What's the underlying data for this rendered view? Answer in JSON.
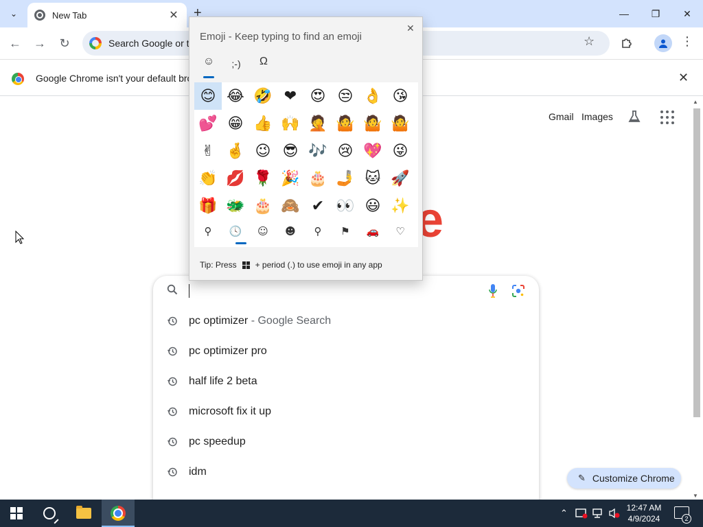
{
  "window": {
    "tab_title": "New Tab",
    "tab_close_glyph": "✕",
    "new_tab_glyph": "+",
    "tab_search_glyph": "⌄",
    "minimize_glyph": "—",
    "restore_glyph": "❐",
    "close_glyph": "✕"
  },
  "toolbar": {
    "back_glyph": "←",
    "forward_glyph": "→",
    "reload_glyph": "↻",
    "omnibox_text": "Search Google or ty",
    "star_glyph": "☆",
    "menu_glyph": "⋮"
  },
  "infobar": {
    "text": "Google Chrome isn't your default brow",
    "close_glyph": "✕"
  },
  "page": {
    "links": {
      "gmail": "Gmail",
      "images": "Images"
    },
    "logo_partial": "e",
    "customize_label": "Customize Chrome",
    "pencil_glyph": "✎"
  },
  "suggestions": [
    {
      "text": "pc optimizer",
      "tail": " - Google Search"
    },
    {
      "text": "pc optimizer pro",
      "tail": ""
    },
    {
      "text": "half life 2 beta",
      "tail": ""
    },
    {
      "text": "microsoft fix it up",
      "tail": ""
    },
    {
      "text": "pc speedup",
      "tail": ""
    },
    {
      "text": "idm",
      "tail": ""
    }
  ],
  "emoji_panel": {
    "title": "Emoji - Keep typing to find an emoji",
    "close_glyph": "✕",
    "tabs": [
      "☺",
      ";-)",
      "Ω"
    ],
    "emojis": [
      [
        "😊",
        "😂",
        "🤣",
        "❤",
        "😍",
        "😒",
        "👌",
        "😘"
      ],
      [
        "💕",
        "😁",
        "👍",
        "🙌",
        "🤦",
        "🤷",
        "🤷",
        "🤷"
      ],
      [
        "✌",
        "🤞",
        "😉",
        "😎",
        "🎶",
        "😢",
        "💖",
        "😜"
      ],
      [
        "👏",
        "💋",
        "🌹",
        "🎉",
        "🎂",
        "🤳",
        "🐱",
        "🚀"
      ],
      [
        "🎁",
        "🐲",
        "🎂",
        "🙈",
        "✔",
        "👀",
        "😃",
        "✨"
      ]
    ],
    "categories": [
      "⚲",
      "🕓",
      "☺",
      "☻",
      "⚲",
      "⚑",
      "🚗",
      "♡"
    ],
    "tip_prefix": "Tip: Press",
    "tip_suffix": "+ period (.) to use emoji in any app"
  },
  "taskbar": {
    "time": "12:47 AM",
    "date": "4/9/2024",
    "notification_count": "2",
    "tray_chevron": "⌃"
  },
  "colors": {
    "accent_blue": "#0b57d0",
    "tab_strip": "#d3e3fd",
    "taskbar": "#1c2a3a"
  }
}
